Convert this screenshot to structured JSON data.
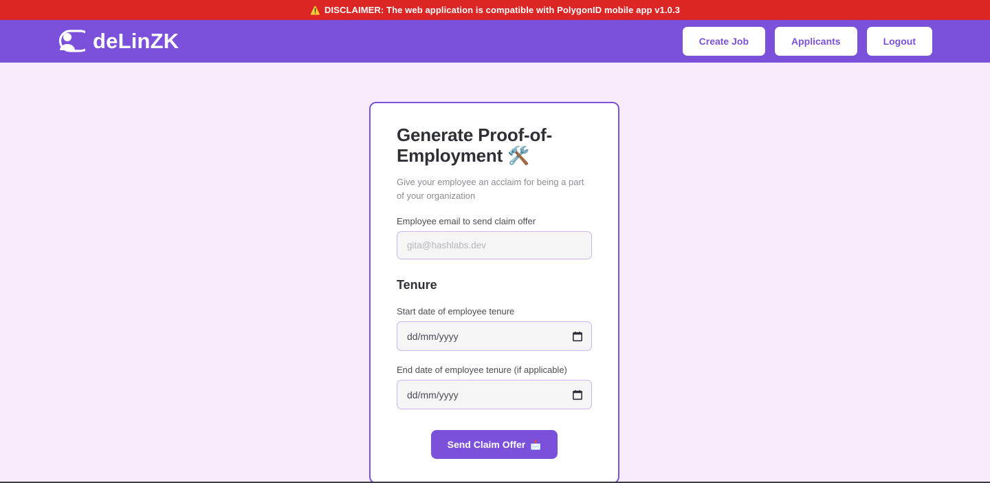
{
  "disclaimer": {
    "icon": "warning-icon",
    "icon_glyph": "⚠️",
    "text": "DISCLAIMER: The web application is compatible with PolygonID mobile app v1.0.3",
    "background_color": "#dc2626",
    "text_color": "#ffffff"
  },
  "navbar": {
    "brand_name": "deLinZK",
    "brand_icon": "person-hexagon-logo-icon",
    "background_color": "#7b51db",
    "buttons": [
      {
        "label": "Create Job",
        "name": "create-job-button"
      },
      {
        "label": "Applicants",
        "name": "applicants-button"
      },
      {
        "label": "Logout",
        "name": "logout-button"
      }
    ]
  },
  "card": {
    "title": "Generate Proof-of-Employment 🛠️",
    "title_emoji": "🛠️",
    "subtitle": "Give your employee an acclaim for being a part of your organization",
    "email_field": {
      "label": "Employee email to send claim offer",
      "value": "",
      "placeholder": "gita@hashlabs.dev"
    },
    "tenure_section_title": "Tenure",
    "start_date_field": {
      "label": "Start date of employee tenure",
      "value": "",
      "placeholder": "dd/mm/yyyy"
    },
    "end_date_field": {
      "label": "End date of employee tenure (if applicable)",
      "value": "",
      "placeholder": "dd/mm/yyyy"
    },
    "submit_button": {
      "label": "Send Claim Offer",
      "emoji": "📩"
    },
    "border_color": "#7b51db",
    "background_color": "#ffffff"
  },
  "page": {
    "background_color": "#f8ebfc"
  }
}
